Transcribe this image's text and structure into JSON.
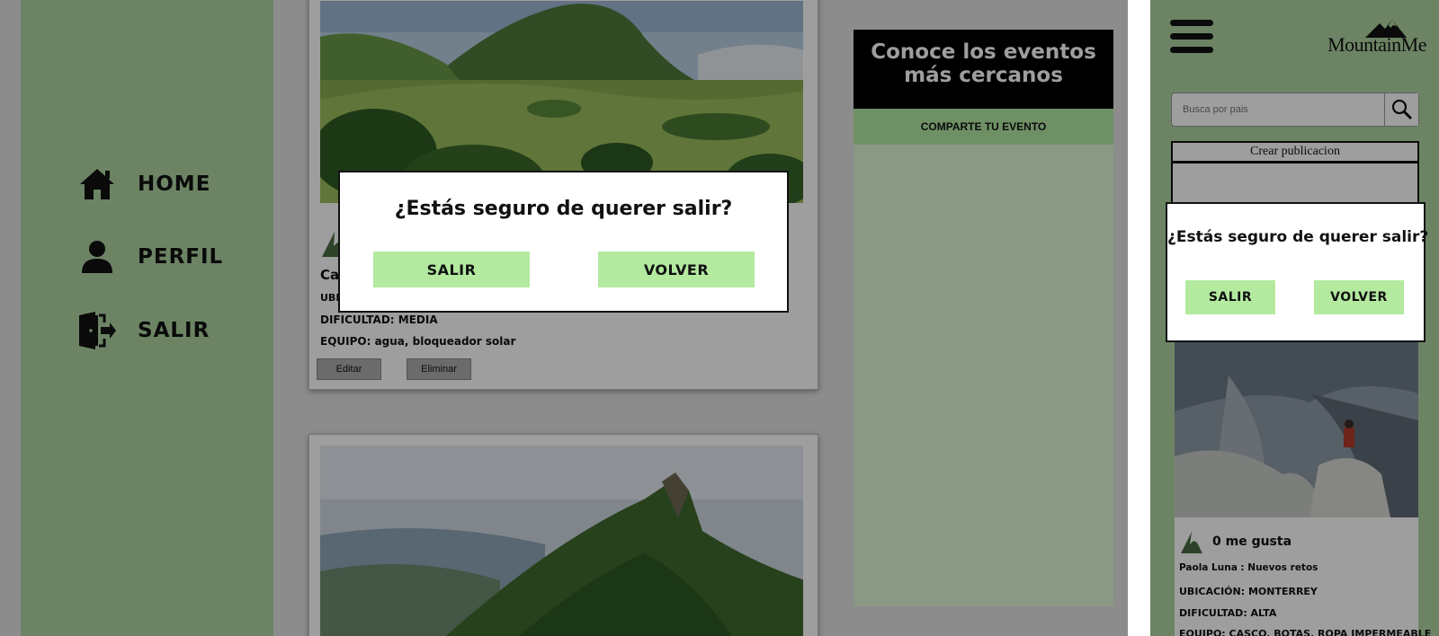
{
  "desktop": {
    "nav": [
      {
        "label": "HOME",
        "icon": "home-icon"
      },
      {
        "label": "PERFIL",
        "icon": "user-icon"
      },
      {
        "label": "SALIR",
        "icon": "logout-icon"
      }
    ],
    "post1": {
      "title_partial": "Ca",
      "location_partial": "UBI",
      "difficulty": "DIFICULTAD: MEDIA",
      "equipment": "EQUIPO: agua, bloqueador solar",
      "edit_label": "Editar",
      "delete_label": "Eliminar"
    },
    "events": {
      "title": "Conoce los eventos más cercanos",
      "share_label": "COMPARTE TU EVENTO"
    },
    "modal": {
      "question": "¿Estás seguro de querer salir?",
      "exit_label": "SALIR",
      "back_label": "VOLVER"
    }
  },
  "mobile": {
    "logo": "MountainMe",
    "search": {
      "placeholder": "Busca por pais"
    },
    "create_label": "Crear publicacion",
    "post": {
      "likes": "0 me gusta",
      "author_line": "Paola Luna : Nuevos retos",
      "location": "UBICACIÓN: MONTERREY",
      "difficulty": "DIFICULTAD: ALTA",
      "equipment": "EQUIPO: CASCO, BOTAS, ROPA IMPERMEABLE"
    },
    "modal": {
      "question": "¿Estás seguro de querer salir?",
      "exit_label": "SALIR",
      "back_label": "VOLVER"
    }
  },
  "colors": {
    "sidebar_green": "#aed5a2",
    "button_green": "#b3ea9f",
    "black": "#000000"
  }
}
